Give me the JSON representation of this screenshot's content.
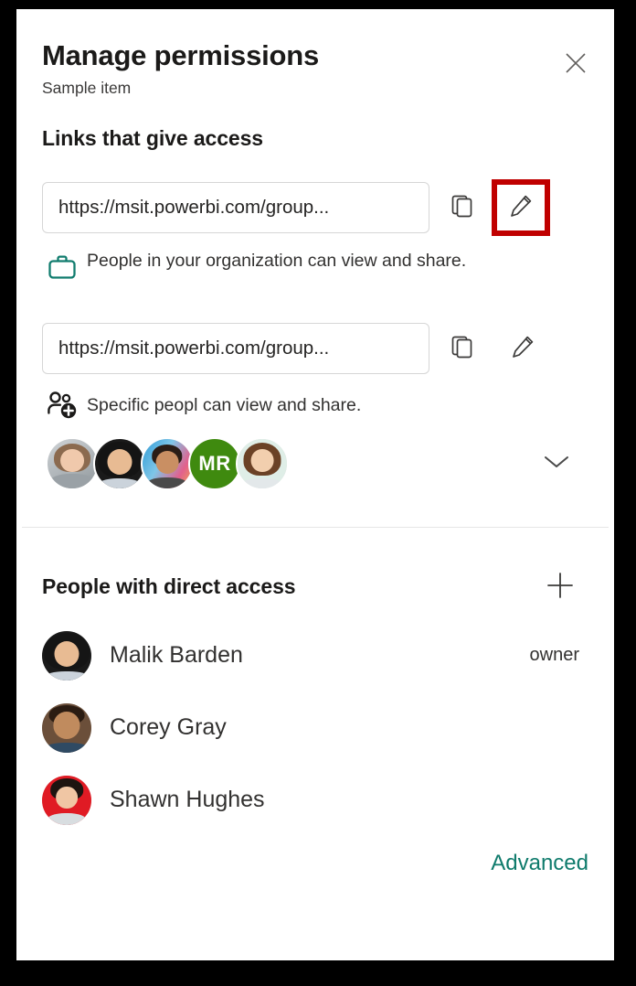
{
  "dialog": {
    "title": "Manage permissions",
    "subtitle": "Sample item",
    "close_icon": "close-icon"
  },
  "links_section": {
    "heading": "Links that give access",
    "links": [
      {
        "url": "https://msit.powerbi.com/group...",
        "copy_icon": "copy-icon",
        "edit_icon": "pencil-icon",
        "permission_text": "People in your organization can view and share.",
        "permission_icon": "briefcase-icon",
        "permission_icon_color": "#107C6E",
        "edit_highlighted": true
      },
      {
        "url": "https://msit.powerbi.com/group...",
        "copy_icon": "copy-icon",
        "edit_icon": "pencil-icon",
        "permission_text": "Specific peopl can view and share.",
        "permission_icon": "people-add-icon",
        "permission_icon_color": "#1b1a19",
        "edit_highlighted": false
      }
    ],
    "avatars": [
      {
        "type": "photo",
        "style": "woman-gray"
      },
      {
        "type": "photo",
        "style": "woman-darkhair"
      },
      {
        "type": "photo",
        "style": "man-glasses"
      },
      {
        "type": "initials",
        "initials": "MR",
        "color": "#3F8A0F"
      },
      {
        "type": "photo",
        "style": "woman-light"
      }
    ],
    "expand_icon": "chevron-down-icon"
  },
  "direct_access": {
    "heading": "People with direct access",
    "add_icon": "plus-icon",
    "people": [
      {
        "name": "Malik Barden",
        "role": "owner",
        "style": "woman-darkhair"
      },
      {
        "name": "Corey Gray",
        "role": "",
        "style": "man-smiling"
      },
      {
        "name": "Shawn Hughes",
        "role": "",
        "style": "woman-red"
      }
    ]
  },
  "footer": {
    "advanced_label": "Advanced",
    "advanced_color": "#0f7b6c"
  },
  "highlight": {
    "color": "#C00000"
  }
}
